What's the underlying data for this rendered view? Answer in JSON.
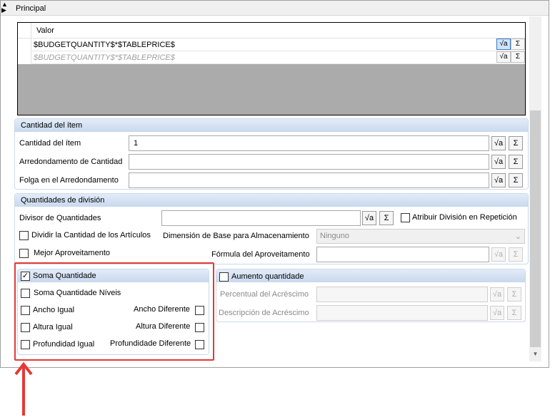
{
  "header": {
    "title": "Principal"
  },
  "grid": {
    "column": "Valor",
    "rows": [
      {
        "value": "$BUDGETQUANTITY$*$TABLEPRICE$",
        "placeholder": false
      },
      {
        "value": "$BUDGETQUANTITY$*$TABLEPRICE$",
        "placeholder": true
      }
    ],
    "formula_icon": "sqrt-a-icon",
    "sum_icon": "Σ"
  },
  "item_qty": {
    "title": "Cantidad del ítem",
    "fields": [
      {
        "label": "Cantidad del ítem",
        "value": "1"
      },
      {
        "label": "Arredondamento de Cantidad",
        "value": ""
      },
      {
        "label": "Folga en el Arredondamento",
        "value": ""
      }
    ]
  },
  "division": {
    "title": "Quantidades de división",
    "divisor_label": "Divisor de Quantidades",
    "divisor_value": "",
    "attrib_label": "Atribuir División en Repetición",
    "attrib_checked": false,
    "dividir_label": "Dividir la Cantidad de los Artículos",
    "dividir_checked": false,
    "dimension_label": "Dimensión de Base para Almacenamiento",
    "dimension_value": "Ninguno",
    "mejor_label": "Mejor Aproveitamento",
    "mejor_checked": false,
    "formula_label": "Fórmula del Aproveitamento",
    "formula_value": ""
  },
  "soma": {
    "title": "Soma Quantidade",
    "checked": true,
    "niveis_label": "Soma Quantidade Níveis",
    "ancho_igual": "Ancho Igual",
    "ancho_diferente": "Ancho Diferente",
    "altura_igual": "Altura Igual",
    "altura_diferente": "Altura Diferente",
    "prof_igual": "Profundidad Igual",
    "prof_diferente": "Profundidade Diferente"
  },
  "aumento": {
    "title": "Aumento quantidade",
    "checked": false,
    "percentual_label": "Percentual del Acréscimo",
    "descripcion_label": "Descripción de Acréscimo"
  },
  "colors": {
    "accent_box": "#e53935",
    "group_header": "#c8d8ee"
  }
}
